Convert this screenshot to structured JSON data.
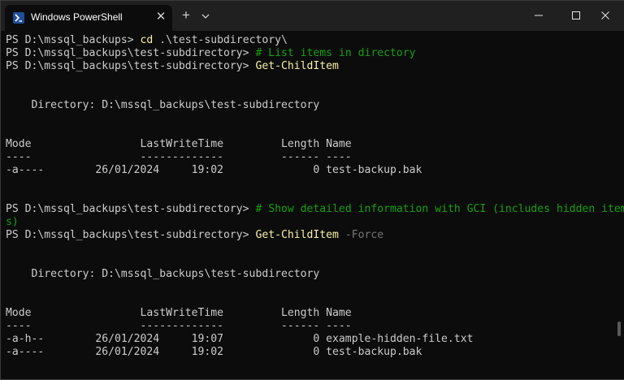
{
  "tab": {
    "title": "Windows PowerShell",
    "close": "✕"
  },
  "toolbar": {
    "new_tab": "+",
    "dropdown_icon": "chevron-down-icon"
  },
  "window_controls": {
    "minimize_icon": "minimize-icon",
    "maximize_icon": "maximize-icon",
    "close_icon": "close-icon"
  },
  "colors": {
    "command": "#f9f1a5",
    "comment": "#13a10e",
    "parameter": "#767676",
    "text": "#cccccc",
    "background": "#0c0c0c"
  },
  "lines": [
    {
      "parts": [
        {
          "t": "PS D:\\mssql_backups> ",
          "c": "text"
        },
        {
          "t": "cd",
          "c": "cmd"
        },
        {
          "t": " .\\test-subdirectory\\",
          "c": "text"
        }
      ]
    },
    {
      "parts": [
        {
          "t": "PS D:\\mssql_backups\\test-subdirectory> ",
          "c": "text"
        },
        {
          "t": "# List items in directory",
          "c": "comment"
        }
      ]
    },
    {
      "parts": [
        {
          "t": "PS D:\\mssql_backups\\test-subdirectory> ",
          "c": "text"
        },
        {
          "t": "Get-ChildItem",
          "c": "cmd"
        }
      ]
    },
    {
      "parts": []
    },
    {
      "parts": []
    },
    {
      "parts": [
        {
          "t": "    Directory: D:\\mssql_backups\\test-subdirectory",
          "c": "text"
        }
      ]
    },
    {
      "parts": []
    },
    {
      "parts": []
    },
    {
      "parts": [
        {
          "t": "Mode                 LastWriteTime         Length Name",
          "c": "text"
        }
      ]
    },
    {
      "parts": [
        {
          "t": "----                 -------------         ------ ----",
          "c": "text"
        }
      ]
    },
    {
      "parts": [
        {
          "t": "-a----        26/01/2024     19:02              0 test-backup.bak",
          "c": "text"
        }
      ]
    },
    {
      "parts": []
    },
    {
      "parts": []
    },
    {
      "parts": [
        {
          "t": "PS D:\\mssql_backups\\test-subdirectory> ",
          "c": "text"
        },
        {
          "t": "# Show detailed information with GCI (includes hidden item",
          "c": "comment"
        }
      ]
    },
    {
      "parts": [
        {
          "t": "s)",
          "c": "comment"
        }
      ]
    },
    {
      "parts": [
        {
          "t": "PS D:\\mssql_backups\\test-subdirectory> ",
          "c": "text"
        },
        {
          "t": "Get-ChildItem",
          "c": "cmd"
        },
        {
          "t": " -Force",
          "c": "param"
        }
      ]
    },
    {
      "parts": []
    },
    {
      "parts": []
    },
    {
      "parts": [
        {
          "t": "    Directory: D:\\mssql_backups\\test-subdirectory",
          "c": "text"
        }
      ]
    },
    {
      "parts": []
    },
    {
      "parts": []
    },
    {
      "parts": [
        {
          "t": "Mode                 LastWriteTime         Length Name",
          "c": "text"
        }
      ]
    },
    {
      "parts": [
        {
          "t": "----                 -------------         ------ ----",
          "c": "text"
        }
      ]
    },
    {
      "parts": [
        {
          "t": "-a-h--        26/01/2024     19:07              0 example-hidden-file.txt",
          "c": "text"
        }
      ]
    },
    {
      "parts": [
        {
          "t": "-a----        26/01/2024     19:02              0 test-backup.bak",
          "c": "text"
        }
      ]
    }
  ]
}
